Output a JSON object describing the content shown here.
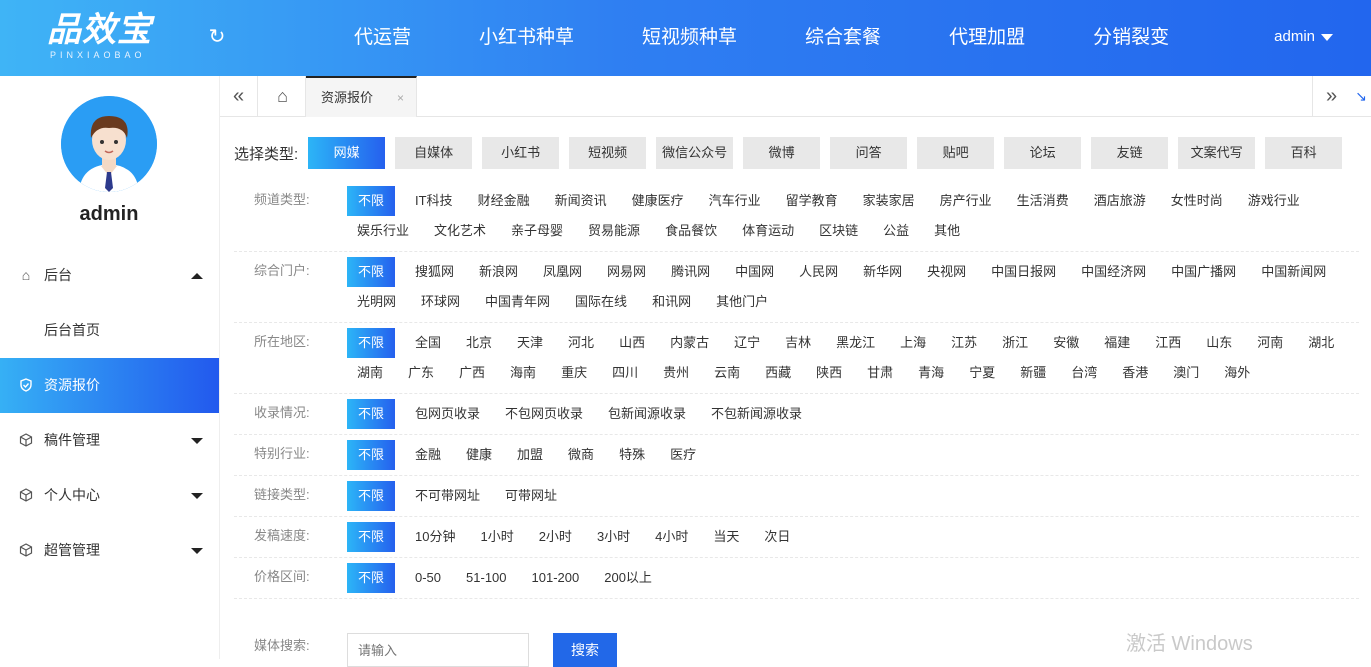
{
  "header": {
    "logo_main": "品效宝",
    "logo_sub": "PINXIAOBAO",
    "nav": [
      "代运营",
      "小红书种草",
      "短视频种草",
      "综合套餐",
      "代理加盟",
      "分销裂变"
    ],
    "user": "admin",
    "colors": {
      "gradient_start": "#3fb4f6",
      "gradient_end": "#2266ee"
    }
  },
  "sidebar": {
    "profile_name": "admin",
    "items": [
      {
        "label": "后台",
        "icon": "home-icon",
        "caret": "up"
      },
      {
        "label": "后台首页",
        "icon": "",
        "caret": ""
      },
      {
        "label": "资源报价",
        "icon": "shield-check-icon",
        "caret": "",
        "active": true
      },
      {
        "label": "稿件管理",
        "icon": "cube-icon",
        "caret": "down"
      },
      {
        "label": "个人中心",
        "icon": "cube-icon",
        "caret": "down"
      },
      {
        "label": "超管管理",
        "icon": "cube-icon",
        "caret": "down"
      }
    ]
  },
  "tabs": {
    "active_label": "资源报价",
    "close_glyph": "×"
  },
  "type_select": {
    "label": "选择类型:",
    "options": [
      "网媒",
      "自媒体",
      "小红书",
      "短视频",
      "微信公众号",
      "微博",
      "问答",
      "贴吧",
      "论坛",
      "友链",
      "文案代写",
      "百科"
    ],
    "active_index": 0
  },
  "filters": [
    {
      "label": "频道类型:",
      "options": [
        "不限",
        "IT科技",
        "财经金融",
        "新闻资讯",
        "健康医疗",
        "汽车行业",
        "留学教育",
        "家装家居",
        "房产行业",
        "生活消费",
        "酒店旅游",
        "女性时尚",
        "游戏行业",
        "娱乐行业",
        "文化艺术",
        "亲子母婴",
        "贸易能源",
        "食品餐饮",
        "体育运动",
        "区块链",
        "公益",
        "其他"
      ]
    },
    {
      "label": "综合门户:",
      "options": [
        "不限",
        "搜狐网",
        "新浪网",
        "凤凰网",
        "网易网",
        "腾讯网",
        "中国网",
        "人民网",
        "新华网",
        "央视网",
        "中国日报网",
        "中国经济网",
        "中国广播网",
        "中国新闻网",
        "光明网",
        "环球网",
        "中国青年网",
        "国际在线",
        "和讯网",
        "其他门户"
      ]
    },
    {
      "label": "所在地区:",
      "options": [
        "不限",
        "全国",
        "北京",
        "天津",
        "河北",
        "山西",
        "内蒙古",
        "辽宁",
        "吉林",
        "黑龙江",
        "上海",
        "江苏",
        "浙江",
        "安徽",
        "福建",
        "江西",
        "山东",
        "河南",
        "湖北",
        "湖南",
        "广东",
        "广西",
        "海南",
        "重庆",
        "四川",
        "贵州",
        "云南",
        "西藏",
        "陕西",
        "甘肃",
        "青海",
        "宁夏",
        "新疆",
        "台湾",
        "香港",
        "澳门",
        "海外"
      ]
    },
    {
      "label": "收录情况:",
      "options": [
        "不限",
        "包网页收录",
        "不包网页收录",
        "包新闻源收录",
        "不包新闻源收录"
      ]
    },
    {
      "label": "特别行业:",
      "options": [
        "不限",
        "金融",
        "健康",
        "加盟",
        "微商",
        "特殊",
        "医疗"
      ]
    },
    {
      "label": "链接类型:",
      "options": [
        "不限",
        "不可带网址",
        "可带网址"
      ]
    },
    {
      "label": "发稿速度:",
      "options": [
        "不限",
        "10分钟",
        "1小时",
        "2小时",
        "3小时",
        "4小时",
        "当天",
        "次日"
      ]
    },
    {
      "label": "价格区间:",
      "options": [
        "不限",
        "0-50",
        "51-100",
        "101-200",
        "200以上"
      ]
    }
  ],
  "search": {
    "label": "媒体搜索:",
    "placeholder": "请输入",
    "button": "搜索"
  },
  "watermark": "激活 Windows"
}
